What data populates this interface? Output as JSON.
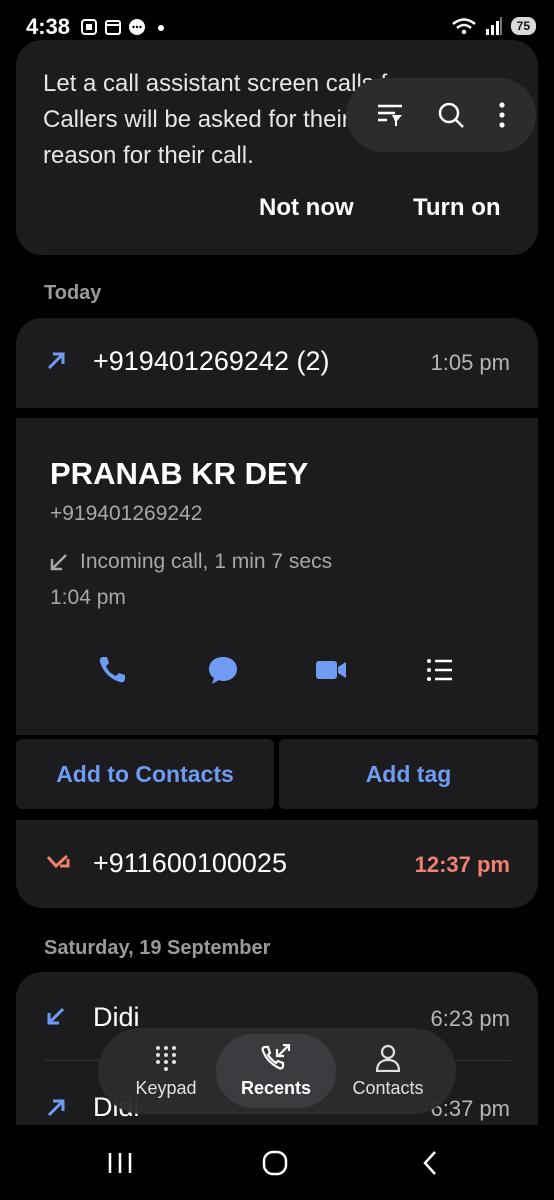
{
  "status_bar": {
    "time": "4:38",
    "battery": "75",
    "icons": [
      "screenshot-icon",
      "calendar-icon",
      "messages-icon",
      "notification-dot-icon",
      "wifi-icon",
      "signal-icon",
      "battery-icon"
    ]
  },
  "promo": {
    "text": "Let a call assistant screen calls for you. Callers will be asked for their name and the reason for their call.",
    "not_now": "Not now",
    "turn_on": "Turn on"
  },
  "toolbar": {
    "icons": [
      "filter-icon",
      "search-icon",
      "more-icon"
    ]
  },
  "sections": {
    "today": "Today",
    "saturday": "Saturday, 19 September"
  },
  "today_calls": [
    {
      "number": "+919401269242 (2)",
      "time": "1:05 pm",
      "type": "outgoing"
    },
    {
      "number": "+911600100025",
      "time": "12:37 pm",
      "type": "missed"
    }
  ],
  "detail": {
    "name": "PRANAB KR DEY",
    "number": "+919401269242",
    "call_info": "Incoming call, 1 min 7 secs",
    "time": "1:04 pm",
    "actions": [
      "phone-icon",
      "message-icon",
      "video-icon",
      "details-icon"
    ],
    "add_to_contacts": "Add to Contacts",
    "add_tag": "Add tag"
  },
  "saturday_calls": [
    {
      "name": "Didi",
      "time": "6:23 pm",
      "type": "incoming"
    },
    {
      "name": "Didi",
      "time": "6:37 pm",
      "type": "outgoing"
    }
  ],
  "bottom_nav": {
    "keypad": "Keypad",
    "recents": "Recents",
    "contacts": "Contacts"
  },
  "colors": {
    "accent": "#6f9cf2",
    "missed": "#f0806f",
    "card": "#1c1c1f"
  }
}
